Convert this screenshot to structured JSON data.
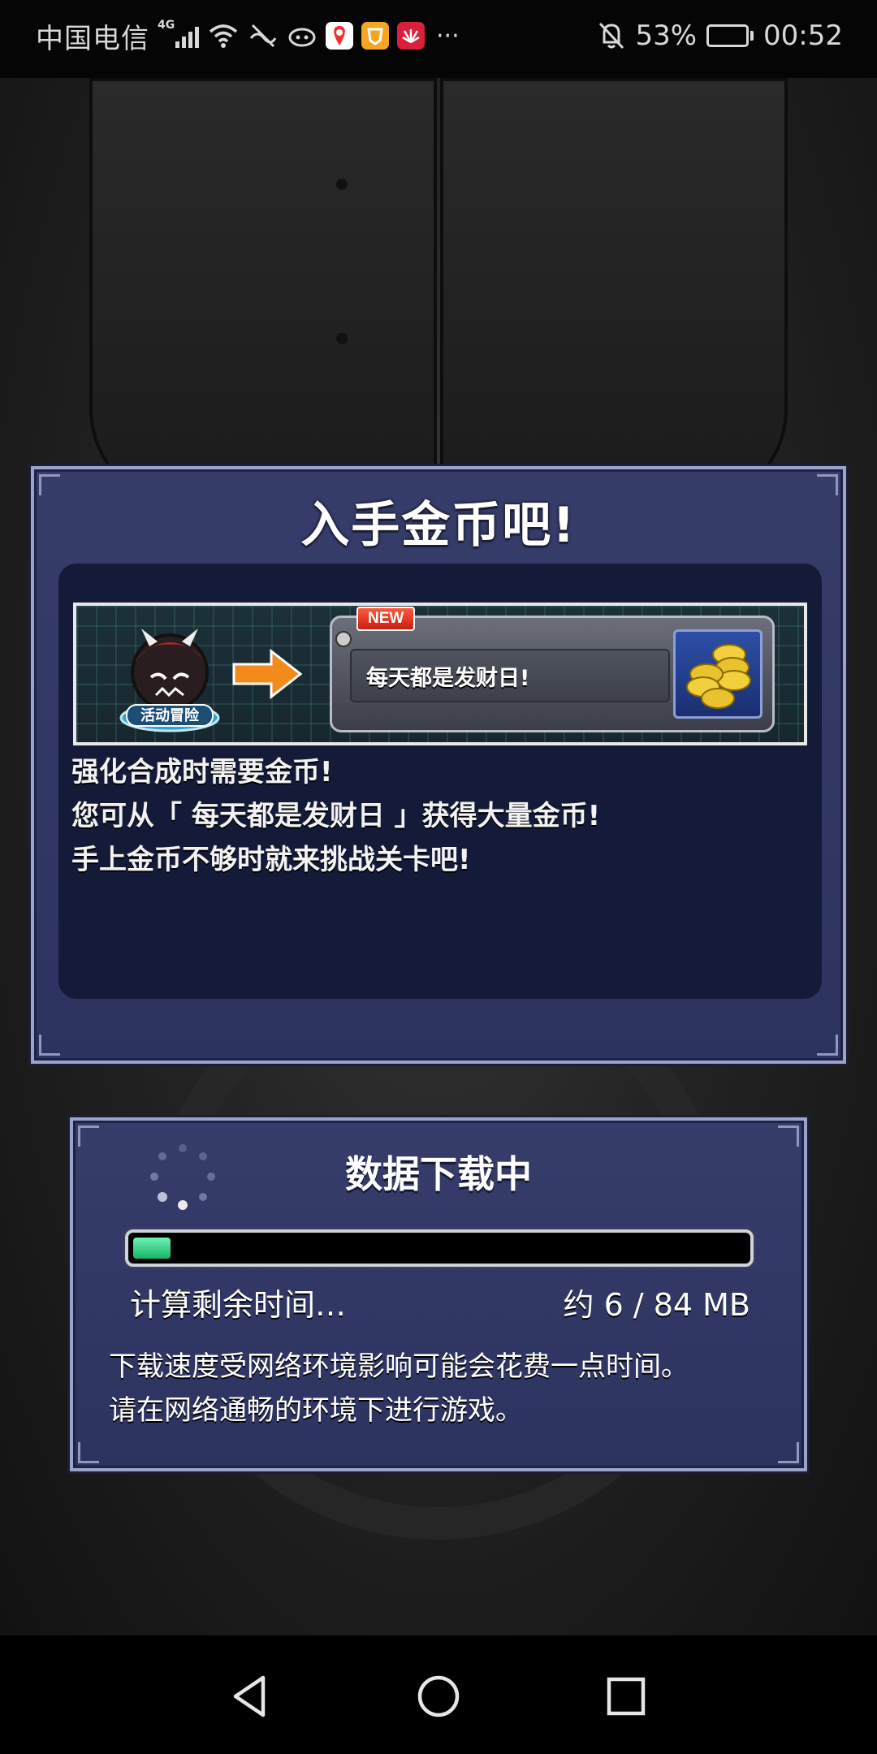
{
  "status_bar": {
    "carrier": "中国电信",
    "network": "4G",
    "battery_percent": "53%",
    "battery_level": 0.53,
    "time": "00:52",
    "more": "···"
  },
  "popup": {
    "title": "入手金币吧!",
    "banner": {
      "badge": "NEW",
      "quest_name": "每天都是发财日!",
      "event_label": "活动冒险"
    },
    "description": [
      "强化合成时需要金币!",
      "您可从「 每天都是发财日 」获得大量金币!",
      "手上金币不够时就来挑战关卡吧!"
    ]
  },
  "download": {
    "title": "数据下载中",
    "status": "计算剩余时间…",
    "size": "约 6 / 84 MB",
    "progress": 0.06,
    "notice": [
      "下载速度受网络环境影响可能会花费一点时间。",
      "请在网络通畅的环境下进行游戏。"
    ]
  },
  "colors": {
    "panel": "#2f3663",
    "panel_border": "#9aa3c8",
    "progress": "#2ed48a",
    "badge": "#e8321e"
  },
  "icons": {
    "status": [
      "signal-icon",
      "wifi-icon",
      "vibrate-icon",
      "cloud-icon",
      "map-app-icon",
      "shop-app-icon",
      "huawei-app-icon",
      "mute-bell-icon",
      "battery-icon"
    ],
    "nav": [
      "back-icon",
      "home-icon",
      "recents-icon"
    ]
  }
}
